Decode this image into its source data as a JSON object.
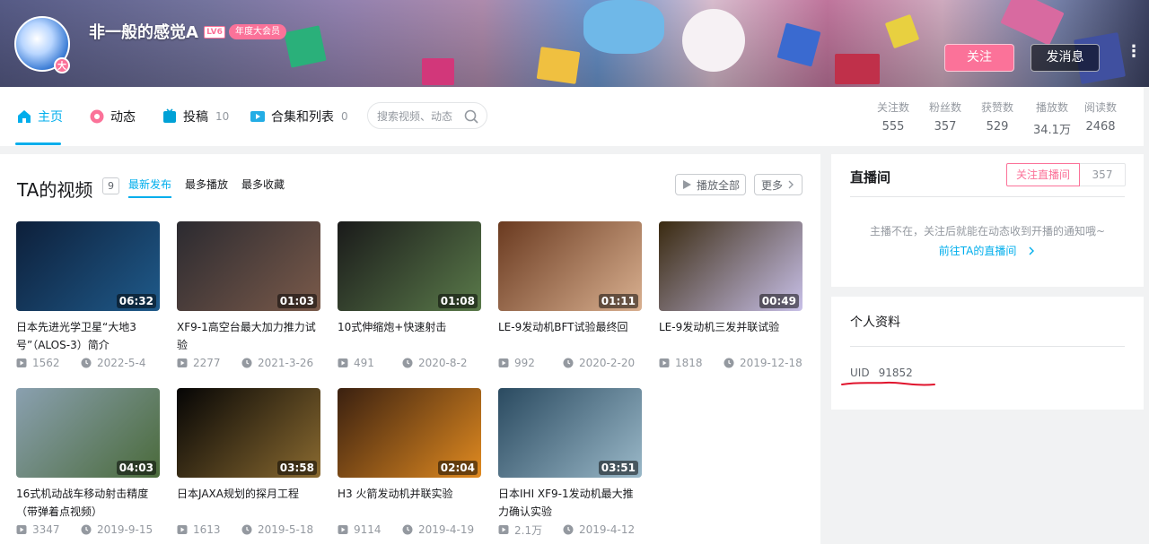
{
  "header": {
    "username": "非一般的感觉A",
    "level": "LV6",
    "vip_label": "年度大会员",
    "avatar_badge": "大",
    "follow_label": "关注",
    "message_label": "发消息",
    "more_label": "⋮"
  },
  "nav": {
    "home": "主页",
    "dynamic": "动态",
    "uploads": "投稿",
    "uploads_count": "10",
    "collections": "合集和列表",
    "collections_count": "0",
    "search_placeholder": "搜索视频、动态"
  },
  "stats": [
    {
      "label": "关注数",
      "value": "555"
    },
    {
      "label": "粉丝数",
      "value": "357"
    },
    {
      "label": "获赞数",
      "value": "529"
    },
    {
      "label": "播放数",
      "value": "34.1万"
    },
    {
      "label": "阅读数",
      "value": "2468"
    }
  ],
  "videos_section": {
    "title": "TA的视频",
    "count": "9",
    "sort_tabs": [
      "最新发布",
      "最多播放",
      "最多收藏"
    ],
    "play_all": "播放全部",
    "more": "更多"
  },
  "videos": [
    {
      "title": "日本先进光学卫星“大地3号”（ALOS-3）简介",
      "duration": "06:32",
      "plays": "1562",
      "date": "2022-5-4",
      "thumb": [
        "#0d1f3a",
        "#1f5a8a"
      ]
    },
    {
      "title": "XF9-1高空台最大加力推力试验",
      "duration": "01:03",
      "plays": "2277",
      "date": "2021-3-26",
      "thumb": [
        "#2b2a30",
        "#7a5a4a"
      ]
    },
    {
      "title": "10式伸缩炮+快速射击",
      "duration": "01:08",
      "plays": "491",
      "date": "2020-8-2",
      "thumb": [
        "#1a1a1a",
        "#5a7a4a"
      ]
    },
    {
      "title": "LE-9发动机BFT试验最终回",
      "duration": "01:11",
      "plays": "992",
      "date": "2020-2-20",
      "thumb": [
        "#6a3a20",
        "#d9b090"
      ]
    },
    {
      "title": "LE-9发动机三发并联试验",
      "duration": "00:49",
      "plays": "1818",
      "date": "2019-12-18",
      "thumb": [
        "#3a2a10",
        "#c8c0e8"
      ]
    },
    {
      "title": "16式机动战车移动射击精度（带弹着点视频）",
      "duration": "04:03",
      "plays": "3347",
      "date": "2019-9-15",
      "thumb": [
        "#8aa0b0",
        "#4a6a3a"
      ]
    },
    {
      "title": "日本JAXA规划的探月工程",
      "duration": "03:58",
      "plays": "1613",
      "date": "2019-5-18",
      "thumb": [
        "#050505",
        "#8a6a30"
      ]
    },
    {
      "title": "H3 火箭发动机并联实验",
      "duration": "02:04",
      "plays": "9114",
      "date": "2019-4-19",
      "thumb": [
        "#3a2010",
        "#e08a20"
      ]
    },
    {
      "title": "日本IHI XF9-1发动机最大推力确认实验",
      "duration": "03:51",
      "plays": "2.1万",
      "date": "2019-4-12",
      "thumb": [
        "#2a4a60",
        "#9ab8c8"
      ]
    }
  ],
  "live": {
    "title": "直播间",
    "follow_btn": "关注直播间",
    "count": "357",
    "message": "主播不在，关注后就能在动态收到开播的通知哦~",
    "link": "前往TA的直播间"
  },
  "profile": {
    "title": "个人资料",
    "uid_label": "UID",
    "uid_value": "91852"
  },
  "colors": {
    "accent": "#00aeec",
    "pink": "#fb7299",
    "annotation": "#e0142d"
  }
}
